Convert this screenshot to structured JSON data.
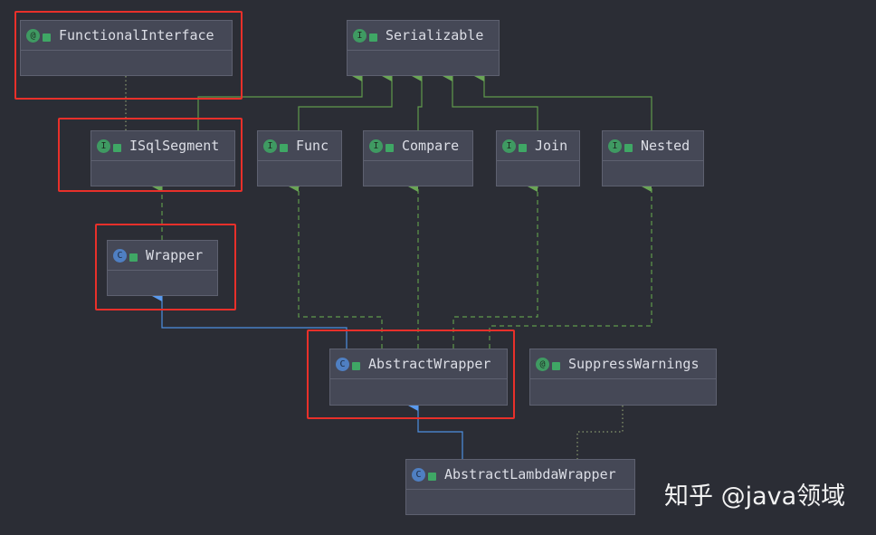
{
  "nodes": {
    "functional_interface": {
      "name": "FunctionalInterface",
      "kind": "annotation",
      "icon": "@"
    },
    "serializable": {
      "name": "Serializable",
      "kind": "interface",
      "icon": "I"
    },
    "isqlsegment": {
      "name": "ISqlSegment",
      "kind": "interface",
      "icon": "I"
    },
    "func": {
      "name": "Func",
      "kind": "interface",
      "icon": "I"
    },
    "compare": {
      "name": "Compare",
      "kind": "interface",
      "icon": "I"
    },
    "join": {
      "name": "Join",
      "kind": "interface",
      "icon": "I"
    },
    "nested": {
      "name": "Nested",
      "kind": "interface",
      "icon": "I"
    },
    "wrapper": {
      "name": "Wrapper",
      "kind": "abstract-class",
      "icon": "C"
    },
    "abstract_wrapper": {
      "name": "AbstractWrapper",
      "kind": "abstract-class",
      "icon": "C"
    },
    "suppress_warnings": {
      "name": "SuppressWarnings",
      "kind": "annotation",
      "icon": "@"
    },
    "abstract_lambda_wrapper": {
      "name": "AbstractLambdaWrapper",
      "kind": "abstract-class",
      "icon": "C"
    }
  },
  "edges": [
    {
      "from": "ISqlSegment",
      "to": "Serializable",
      "type": "extends"
    },
    {
      "from": "Func",
      "to": "Serializable",
      "type": "extends"
    },
    {
      "from": "Compare",
      "to": "Serializable",
      "type": "extends"
    },
    {
      "from": "Join",
      "to": "Serializable",
      "type": "extends"
    },
    {
      "from": "Nested",
      "to": "Serializable",
      "type": "extends"
    },
    {
      "from": "ISqlSegment",
      "to": "FunctionalInterface",
      "type": "annotated"
    },
    {
      "from": "Wrapper",
      "to": "ISqlSegment",
      "type": "implements"
    },
    {
      "from": "AbstractWrapper",
      "to": "Wrapper",
      "type": "extends"
    },
    {
      "from": "AbstractWrapper",
      "to": "Func",
      "type": "implements"
    },
    {
      "from": "AbstractWrapper",
      "to": "Compare",
      "type": "implements"
    },
    {
      "from": "AbstractWrapper",
      "to": "Join",
      "type": "implements"
    },
    {
      "from": "AbstractWrapper",
      "to": "Nested",
      "type": "implements"
    },
    {
      "from": "AbstractLambdaWrapper",
      "to": "AbstractWrapper",
      "type": "extends"
    },
    {
      "from": "AbstractLambdaWrapper",
      "to": "SuppressWarnings",
      "type": "annotated"
    }
  ],
  "colors": {
    "background": "#2b2d35",
    "interface_edge": "#5f9a4c",
    "class_edge": "#4d8fe0",
    "highlight": "#e8302a"
  },
  "watermark": "知乎 @java领域"
}
